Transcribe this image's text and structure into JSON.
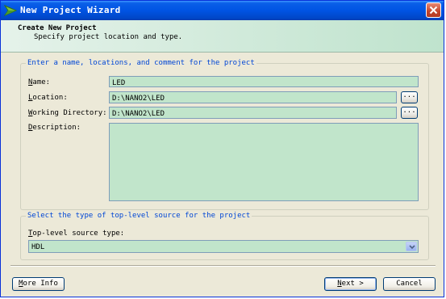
{
  "window": {
    "title": "New Project Wizard",
    "close_icon": "close-icon"
  },
  "header": {
    "title": "Create New Project",
    "subtitle": "Specify project location and type."
  },
  "project_group": {
    "legend": "Enter a name, locations, and comment for the project",
    "name_label_key": "N",
    "name_label_rest": "ame:",
    "name_value": "LED",
    "location_label_key": "L",
    "location_label_rest": "ocation:",
    "location_value": "D:\\NANO2\\LED",
    "workdir_label_key": "W",
    "workdir_label_rest": "orking Directory:",
    "workdir_value": "D:\\NANO2\\LED",
    "description_label_key": "D",
    "description_label_rest": "escription:",
    "description_value": "",
    "browse_label": "..."
  },
  "source_group": {
    "legend": "Select the type of top-level source for the project",
    "type_label_key": "T",
    "type_label_rest": "op-level source type:",
    "type_value": "HDL"
  },
  "buttons": {
    "more_info_key": "M",
    "more_info_rest": "ore Info",
    "next_key": "N",
    "next_rest": "ext >",
    "cancel": "Cancel"
  },
  "colors": {
    "title_bar": "#0054e3",
    "field_bg": "#c1e5cb",
    "legend_text": "#0046d5"
  }
}
